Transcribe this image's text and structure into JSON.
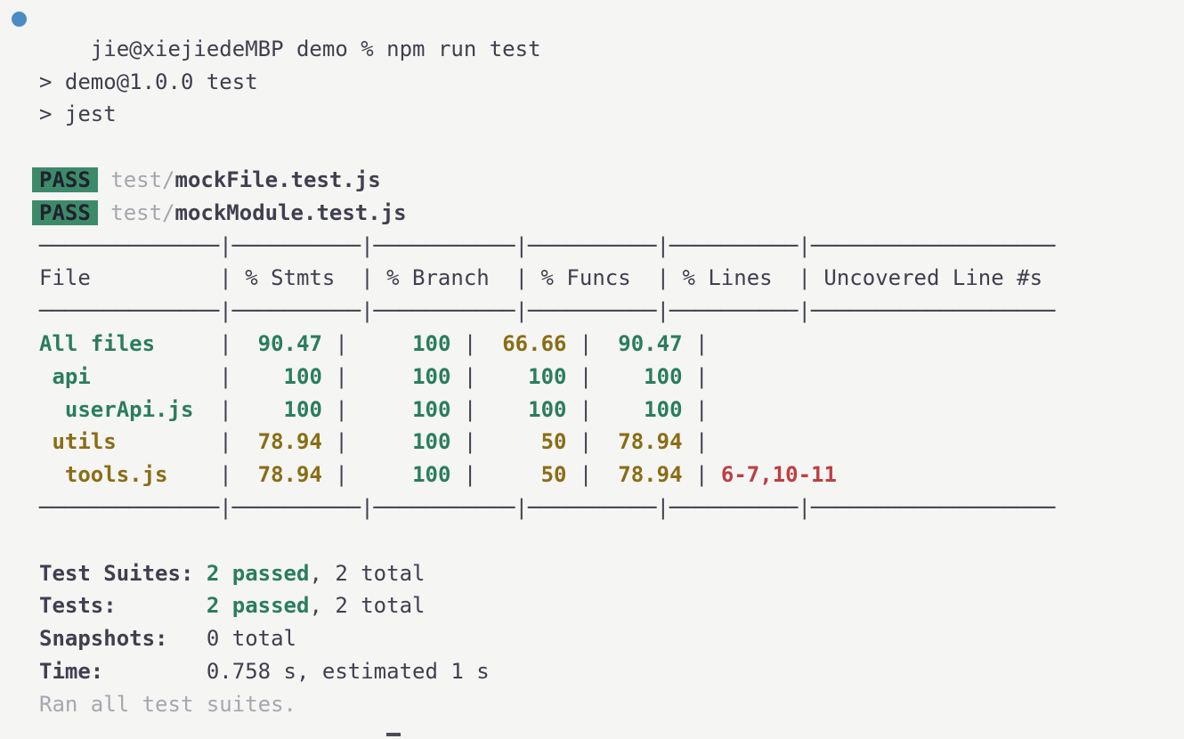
{
  "terminal": {
    "prompt": {
      "dot": "blue-status-dot",
      "text": "jie@xiejiedeMBP demo % ",
      "command": "npm run test"
    },
    "npm_output": [
      "> demo@1.0.0 test",
      "> jest"
    ],
    "suites": [
      {
        "status": "PASS",
        "dir": "test/",
        "file": "mockFile.test.js"
      },
      {
        "status": "PASS",
        "dir": "test/",
        "file": "mockModule.test.js"
      }
    ],
    "coverage_table": {
      "separator": "──────────────|──────────|───────────|──────────|──────────|───────────────────",
      "headers": [
        "File",
        "% Stmts",
        "% Branch",
        "% Funcs",
        "% Lines",
        "Uncovered Line #s"
      ],
      "header_line": "File          | % Stmts  | % Branch  | % Funcs  | % Lines  | Uncovered Line #s",
      "rows": [
        {
          "name": "All files",
          "indent": 0,
          "name_color": "green",
          "cells": [
            {
              "value": "90.47",
              "color": "green"
            },
            {
              "value": "100",
              "color": "green"
            },
            {
              "value": "66.66",
              "color": "olive"
            },
            {
              "value": "90.47",
              "color": "green"
            },
            {
              "value": "",
              "color": "red"
            }
          ]
        },
        {
          "name": "api",
          "indent": 1,
          "name_color": "green",
          "cells": [
            {
              "value": "100",
              "color": "green"
            },
            {
              "value": "100",
              "color": "green"
            },
            {
              "value": "100",
              "color": "green"
            },
            {
              "value": "100",
              "color": "green"
            },
            {
              "value": "",
              "color": "red"
            }
          ]
        },
        {
          "name": "userApi.js",
          "indent": 2,
          "name_color": "green",
          "cells": [
            {
              "value": "100",
              "color": "green"
            },
            {
              "value": "100",
              "color": "green"
            },
            {
              "value": "100",
              "color": "green"
            },
            {
              "value": "100",
              "color": "green"
            },
            {
              "value": "",
              "color": "red"
            }
          ]
        },
        {
          "name": "utils",
          "indent": 1,
          "name_color": "olive",
          "cells": [
            {
              "value": "78.94",
              "color": "olive"
            },
            {
              "value": "100",
              "color": "green"
            },
            {
              "value": "50",
              "color": "olive"
            },
            {
              "value": "78.94",
              "color": "olive"
            },
            {
              "value": "",
              "color": "red"
            }
          ]
        },
        {
          "name": "tools.js",
          "indent": 2,
          "name_color": "olive",
          "cells": [
            {
              "value": "78.94",
              "color": "olive"
            },
            {
              "value": "100",
              "color": "green"
            },
            {
              "value": "50",
              "color": "olive"
            },
            {
              "value": "78.94",
              "color": "olive"
            },
            {
              "value": "6-7,10-11",
              "color": "red"
            }
          ]
        }
      ]
    },
    "summary": [
      {
        "label": "Test Suites:",
        "highlight": "2 passed",
        "rest": ", 2 total"
      },
      {
        "label": "Tests:",
        "highlight": "2 passed",
        "rest": ", 2 total"
      },
      {
        "label": "Snapshots:",
        "highlight": "",
        "rest": "0 total"
      },
      {
        "label": "Time:",
        "highlight": "",
        "rest": "0.758 s, estimated 1 s"
      }
    ],
    "footer": "Ran all test suites.",
    "colors": {
      "background": "#f5f5f4",
      "foreground": "#3f3f4e",
      "green": "#2a7d5f",
      "olive": "#8a6d14",
      "red": "#bc3f42",
      "grey": "#a6a6ae",
      "badge_bg": "#3d8a6a",
      "prompt_dot": "#4a8cc4"
    }
  }
}
